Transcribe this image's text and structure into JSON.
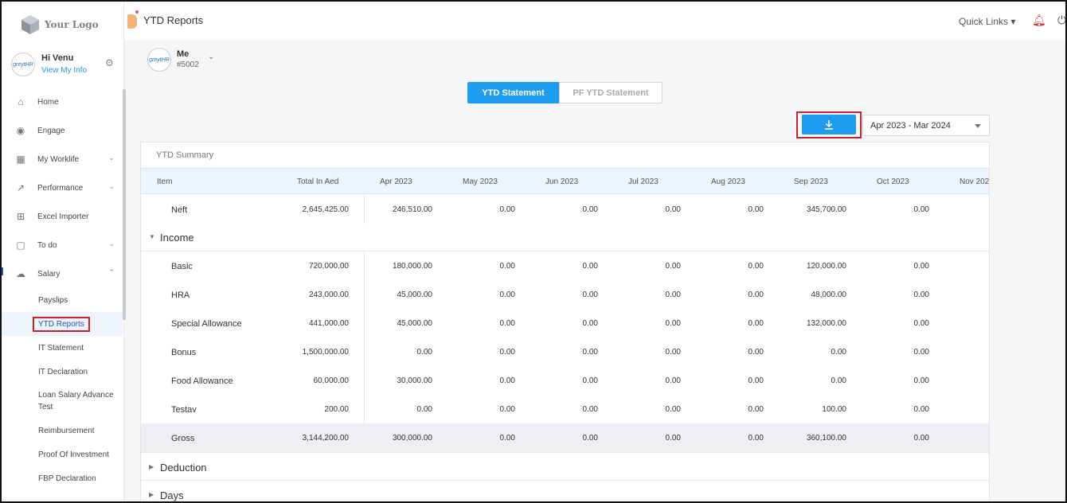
{
  "logo": {
    "text": "Your Logo"
  },
  "user": {
    "greeting": "Hi Venu",
    "view_info": "View My Info",
    "avatar_text": "greytHR"
  },
  "nav": {
    "items": [
      {
        "label": "Home",
        "icon": "home-icon",
        "chevron": ""
      },
      {
        "label": "Engage",
        "icon": "broadcast-icon",
        "chevron": ""
      },
      {
        "label": "My Worklife",
        "icon": "grid-icon",
        "chevron": "⌄"
      },
      {
        "label": "Performance",
        "icon": "chart-line-icon",
        "chevron": "⌄"
      },
      {
        "label": "Excel Importer",
        "icon": "table-icon",
        "chevron": ""
      },
      {
        "label": "To do",
        "icon": "clipboard-icon",
        "chevron": "⌄"
      },
      {
        "label": "Salary",
        "icon": "hand-money-icon",
        "chevron": "⌃"
      }
    ],
    "salary_sub": [
      {
        "label": "Payslips"
      },
      {
        "label": "YTD Reports"
      },
      {
        "label": "IT Statement"
      },
      {
        "label": "IT Declaration"
      },
      {
        "label": "Loan Salary Advance Test"
      },
      {
        "label": "Reimbursement"
      },
      {
        "label": "Proof Of Investment"
      },
      {
        "label": "FBP Declaration"
      }
    ]
  },
  "header": {
    "title": "YTD Reports",
    "quick_links": "Quick Links ▾"
  },
  "employee": {
    "name": "Me",
    "id": "#5002",
    "avatar_text": "greytHR"
  },
  "tabs": {
    "ytd": "YTD Statement",
    "pf": "PF YTD Statement"
  },
  "period": {
    "selected": "Apr 2023 - Mar 2024"
  },
  "summary": {
    "title": "YTD Summary",
    "columns": [
      "Item",
      "Total In Aed",
      "Apr 2023",
      "May 2023",
      "Jun 2023",
      "Jul 2023",
      "Aug 2023",
      "Sep 2023",
      "Oct 2023",
      "Nov 202"
    ],
    "neft": {
      "label": "Neft",
      "values": [
        "2,645,425.00",
        "246,510.00",
        "0.00",
        "0.00",
        "0.00",
        "0.00",
        "345,700.00",
        "0.00"
      ]
    },
    "income_label": "Income",
    "income_rows": [
      {
        "label": "Basic",
        "values": [
          "720,000.00",
          "180,000.00",
          "0.00",
          "0.00",
          "0.00",
          "0.00",
          "120,000.00",
          "0.00"
        ]
      },
      {
        "label": "HRA",
        "values": [
          "243,000.00",
          "45,000.00",
          "0.00",
          "0.00",
          "0.00",
          "0.00",
          "48,000.00",
          "0.00"
        ]
      },
      {
        "label": "Special Allowance",
        "values": [
          "441,000.00",
          "45,000.00",
          "0.00",
          "0.00",
          "0.00",
          "0.00",
          "132,000.00",
          "0.00"
        ]
      },
      {
        "label": "Bonus",
        "values": [
          "1,500,000.00",
          "0.00",
          "0.00",
          "0.00",
          "0.00",
          "0.00",
          "0.00",
          "0.00"
        ]
      },
      {
        "label": "Food Allowance",
        "values": [
          "60,000.00",
          "30,000.00",
          "0.00",
          "0.00",
          "0.00",
          "0.00",
          "0.00",
          "0.00"
        ]
      },
      {
        "label": "Testav",
        "values": [
          "200.00",
          "0.00",
          "0.00",
          "0.00",
          "0.00",
          "0.00",
          "100.00",
          "0.00"
        ]
      }
    ],
    "gross": {
      "label": "Gross",
      "values": [
        "3,144,200.00",
        "300,000.00",
        "0.00",
        "0.00",
        "0.00",
        "0.00",
        "360,100.00",
        "0.00"
      ]
    },
    "deduction_label": "Deduction",
    "days_label": "Days"
  }
}
